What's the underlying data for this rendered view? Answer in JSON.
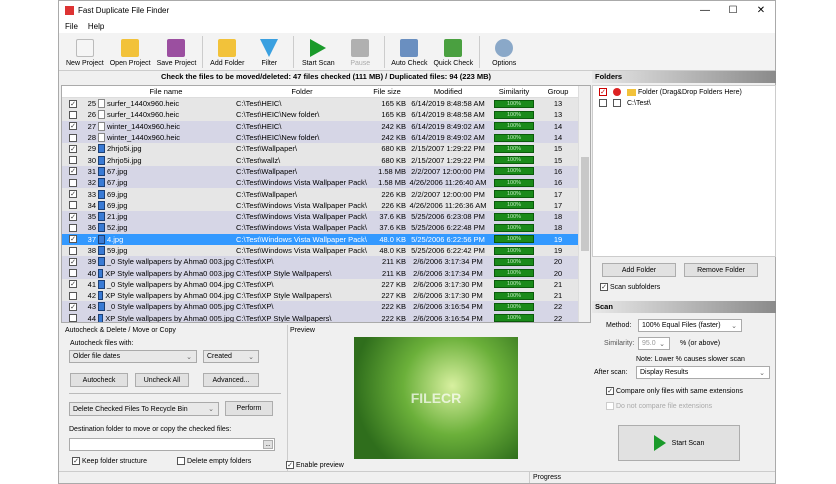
{
  "window": {
    "title": "Fast Duplicate File Finder",
    "minimize": "—",
    "maximize": "☐",
    "close": "✕"
  },
  "menu": [
    "File",
    "Help"
  ],
  "toolbar": [
    {
      "label": "New Project",
      "icon": "new-project-icon",
      "color": "#f5f5f5"
    },
    {
      "label": "Open Project",
      "icon": "open-project-icon",
      "color": "#f2c23a"
    },
    {
      "label": "Save Project",
      "icon": "save-project-icon",
      "color": "#9b4fa0"
    },
    {
      "label": "Add Folder",
      "icon": "add-folder-icon",
      "color": "#f2c23a"
    },
    {
      "label": "Filter",
      "icon": "filter-icon",
      "color": "#3aa0e0"
    },
    {
      "label": "Start Scan",
      "icon": "play-icon",
      "color": "#1a9a2a"
    },
    {
      "label": "Pause",
      "icon": "pause-icon",
      "color": "#b0b0b0"
    },
    {
      "label": "Auto Check",
      "icon": "auto-check-icon",
      "color": "#6a8fc0"
    },
    {
      "label": "Quick Check",
      "icon": "quick-check-icon",
      "color": "#4aa040"
    },
    {
      "label": "Options",
      "icon": "gear-icon",
      "color": "#8aa8c8"
    }
  ],
  "summary": "Check the files to be moved/deleted: 47 files checked (111 MB) / Duplicated files: 94 (223 MB)",
  "table": {
    "headers": [
      "File name",
      "Folder",
      "File size",
      "Modified",
      "Similarity",
      "Group"
    ],
    "rows": [
      {
        "n": "25",
        "checked": true,
        "name": "surfer_1440x960.heic",
        "img": false,
        "folder": "C:\\Test\\HEIC\\",
        "size": "165 KB",
        "modified": "6/14/2019 8:48:58 AM",
        "sim": "100%",
        "group": "13"
      },
      {
        "n": "26",
        "checked": false,
        "name": "surfer_1440x960.heic",
        "img": false,
        "folder": "C:\\Test\\HEIC\\New folder\\",
        "size": "165 KB",
        "modified": "6/14/2019 8:48:58 AM",
        "sim": "100%",
        "group": "13"
      },
      {
        "n": "27",
        "checked": true,
        "name": "winter_1440x960.heic",
        "img": false,
        "folder": "C:\\Test\\HEIC\\",
        "size": "242 KB",
        "modified": "6/14/2019 8:49:02 AM",
        "sim": "100%",
        "group": "14"
      },
      {
        "n": "28",
        "checked": false,
        "name": "winter_1440x960.heic",
        "img": false,
        "folder": "C:\\Test\\HEIC\\New folder\\",
        "size": "242 KB",
        "modified": "6/14/2019 8:49:02 AM",
        "sim": "100%",
        "group": "14"
      },
      {
        "n": "29",
        "checked": true,
        "name": "2hrjo5i.jpg",
        "img": true,
        "folder": "C:\\Test\\Wallpaper\\",
        "size": "680 KB",
        "modified": "2/15/2007 1:29:22 PM",
        "sim": "100%",
        "group": "15"
      },
      {
        "n": "30",
        "checked": false,
        "name": "2hrjo5i.jpg",
        "img": true,
        "folder": "C:\\Test\\wallz\\",
        "size": "680 KB",
        "modified": "2/15/2007 1:29:22 PM",
        "sim": "100%",
        "group": "15"
      },
      {
        "n": "31",
        "checked": true,
        "name": "67.jpg",
        "img": true,
        "folder": "C:\\Test\\Wallpaper\\",
        "size": "1.58 MB",
        "modified": "2/2/2007 12:00:00 PM",
        "sim": "100%",
        "group": "16"
      },
      {
        "n": "32",
        "checked": false,
        "name": "67.jpg",
        "img": true,
        "folder": "C:\\Test\\Windows Vista Wallpaper Pack\\",
        "size": "1.58 MB",
        "modified": "4/26/2006 11:26:40 AM",
        "sim": "100%",
        "group": "16"
      },
      {
        "n": "33",
        "checked": true,
        "name": "69.jpg",
        "img": true,
        "folder": "C:\\Test\\Wallpaper\\",
        "size": "226 KB",
        "modified": "2/2/2007 12:00:00 PM",
        "sim": "100%",
        "group": "17"
      },
      {
        "n": "34",
        "checked": false,
        "name": "69.jpg",
        "img": true,
        "folder": "C:\\Test\\Windows Vista Wallpaper Pack\\",
        "size": "226 KB",
        "modified": "4/26/2006 11:26:36 AM",
        "sim": "100%",
        "group": "17"
      },
      {
        "n": "35",
        "checked": true,
        "name": "21.jpg",
        "img": true,
        "folder": "C:\\Test\\Windows Vista Wallpaper Pack\\",
        "size": "37.6 KB",
        "modified": "5/25/2006 6:23:08 PM",
        "sim": "100%",
        "group": "18"
      },
      {
        "n": "36",
        "checked": false,
        "name": "52.jpg",
        "img": true,
        "folder": "C:\\Test\\Windows Vista Wallpaper Pack\\",
        "size": "37.6 KB",
        "modified": "5/25/2006 6:22:48 PM",
        "sim": "100%",
        "group": "18"
      },
      {
        "n": "37",
        "checked": true,
        "name": "4.jpg",
        "img": true,
        "folder": "C:\\Test\\Windows Vista Wallpaper Pack\\",
        "size": "48.0 KB",
        "modified": "5/25/2006 6:22:56 PM",
        "sim": "100%",
        "group": "19",
        "selected": true
      },
      {
        "n": "38",
        "checked": false,
        "name": "59.jpg",
        "img": true,
        "folder": "C:\\Test\\Windows Vista Wallpaper Pack\\",
        "size": "48.0 KB",
        "modified": "5/25/2006 6:22:42 PM",
        "sim": "100%",
        "group": "19"
      },
      {
        "n": "39",
        "checked": true,
        "name": "_0 Style wallpapers by Ahma0 003.jpg",
        "img": true,
        "folder": "C:\\Test\\XP\\",
        "size": "211 KB",
        "modified": "2/6/2006 3:17:34 PM",
        "sim": "100%",
        "group": "20"
      },
      {
        "n": "40",
        "checked": false,
        "name": "XP Style wallpapers by Ahma0 003.jpg",
        "img": true,
        "folder": "C:\\Test\\XP Style Wallpapers\\",
        "size": "211 KB",
        "modified": "2/6/2006 3:17:34 PM",
        "sim": "100%",
        "group": "20"
      },
      {
        "n": "41",
        "checked": true,
        "name": "_0 Style wallpapers by Ahma0 004.jpg",
        "img": true,
        "folder": "C:\\Test\\XP\\",
        "size": "227 KB",
        "modified": "2/6/2006 3:17:30 PM",
        "sim": "100%",
        "group": "21"
      },
      {
        "n": "42",
        "checked": false,
        "name": "XP Style wallpapers by Ahma0 004.jpg",
        "img": true,
        "folder": "C:\\Test\\XP Style Wallpapers\\",
        "size": "227 KB",
        "modified": "2/6/2006 3:17:30 PM",
        "sim": "100%",
        "group": "21"
      },
      {
        "n": "43",
        "checked": true,
        "name": "_0 Style wallpapers by Ahma0 005.jpg",
        "img": true,
        "folder": "C:\\Test\\XP\\",
        "size": "222 KB",
        "modified": "2/6/2006 3:16:54 PM",
        "sim": "100%",
        "group": "22"
      },
      {
        "n": "44",
        "checked": false,
        "name": "XP Style wallpapers by Ahma0 005.jpg",
        "img": true,
        "folder": "C:\\Test\\XP Style Wallpapers\\",
        "size": "222 KB",
        "modified": "2/6/2006 3:16:54 PM",
        "sim": "100%",
        "group": "22"
      }
    ]
  },
  "folders": {
    "title": "Folders",
    "items": [
      "Folder (Drag&Drop Folders Here)",
      "C:\\Test\\"
    ],
    "add": "Add Folder",
    "remove": "Remove Folder",
    "scan_subfolders": "Scan subfolders"
  },
  "scan": {
    "title": "Scan",
    "method_label": "Method:",
    "method": "100% Equal Files (faster)",
    "similarity_label": "Similarity:",
    "similarity": "95.0",
    "similarity_unit": "% (or above)",
    "note": "Note: Lower % causes slower scan",
    "after_label": "After scan:",
    "after": "Display Results",
    "compare_same_ext": "Compare only files with same extensions",
    "no_compare_ext": "Do not compare file extensions",
    "start": "Start Scan"
  },
  "autocheck": {
    "title": "Autocheck & Delete / Move or Copy",
    "with_label": "Autocheck files with:",
    "criteria": "Older file dates",
    "date_type": "Created",
    "autocheck": "Autocheck",
    "uncheck_all": "Uncheck All",
    "advanced": "Advanced...",
    "action": "Delete Checked Files To Recycle Bin",
    "perform": "Perform",
    "dest_label": "Destination folder to move or copy the checked files:",
    "dest_value": "",
    "browse": "...",
    "keep_structure": "Keep folder structure",
    "delete_empty": "Delete empty folders"
  },
  "preview": {
    "title": "Preview",
    "enable": "Enable preview",
    "watermark": "FILECR"
  },
  "status": {
    "progress": "Progress"
  }
}
